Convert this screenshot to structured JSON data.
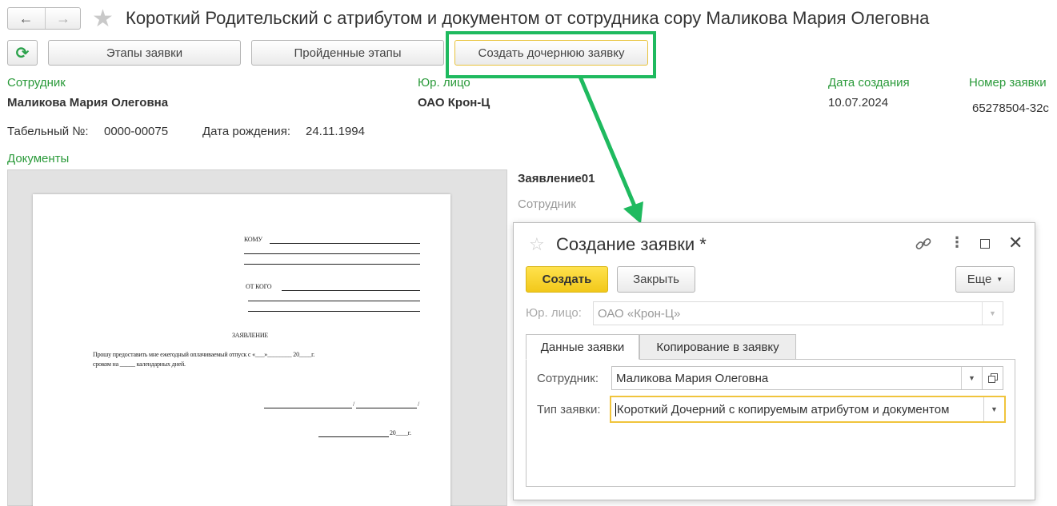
{
  "window": {
    "back_icon": "←",
    "forward_icon": "→",
    "title": "Короткий Родительский с атрибутом и документом от сотрудника сору Маликова Мария Олеговна"
  },
  "toolbar": {
    "refresh_icon": "⟳",
    "stages_label": "Этапы заявки",
    "passed_label": "Пройденные этапы",
    "create_child_label": "Создать дочернюю заявку"
  },
  "info": {
    "employee_label": "Сотрудник",
    "employee_value": "Маликова Мария Олеговна",
    "legal_label": "Юр. лицо",
    "legal_value": "ОАО Крон-Ц",
    "created_label": "Дата создания",
    "created_value": "10.07.2024",
    "number_label": "Номер заявки",
    "number_value": "65278504-32c",
    "tab_no_label": "Табельный №:",
    "tab_no_value": "0000-00075",
    "birth_label": "Дата рождения:",
    "birth_value": "24.11.1994",
    "docs_label": "Документы"
  },
  "doc_panel": {
    "title": "Заявление01",
    "sub": "Сотрудник"
  },
  "paper": {
    "to": "КОМУ",
    "from": "ОТ КОГО",
    "heading": "ЗАЯВЛЕНИЕ",
    "line1": "Прошу предоставить мне ежегодный оплачиваемый отпуск с «___»________ 20____г.",
    "line2": "сроком на _____ календарных дней.",
    "sign": "/",
    "date": "20____г."
  },
  "dialog": {
    "title": "Создание заявки *",
    "create_label": "Создать",
    "close_label": "Закрыть",
    "more_label": "Еще",
    "legal_label": "Юр. лицо:",
    "legal_value": "ОАО «Крон-Ц»",
    "tab1": "Данные заявки",
    "tab2": "Копирование в заявку",
    "employee_label": "Сотрудник:",
    "employee_value": "Маликова Мария Олеговна",
    "type_label": "Тип заявки:",
    "type_value": "Короткий Дочерний с копируемым атрибутом и документом"
  },
  "colors": {
    "accent_green": "#1fba5f",
    "label_green": "#2a9a3a",
    "primary_yellow": "#f2c81a"
  }
}
